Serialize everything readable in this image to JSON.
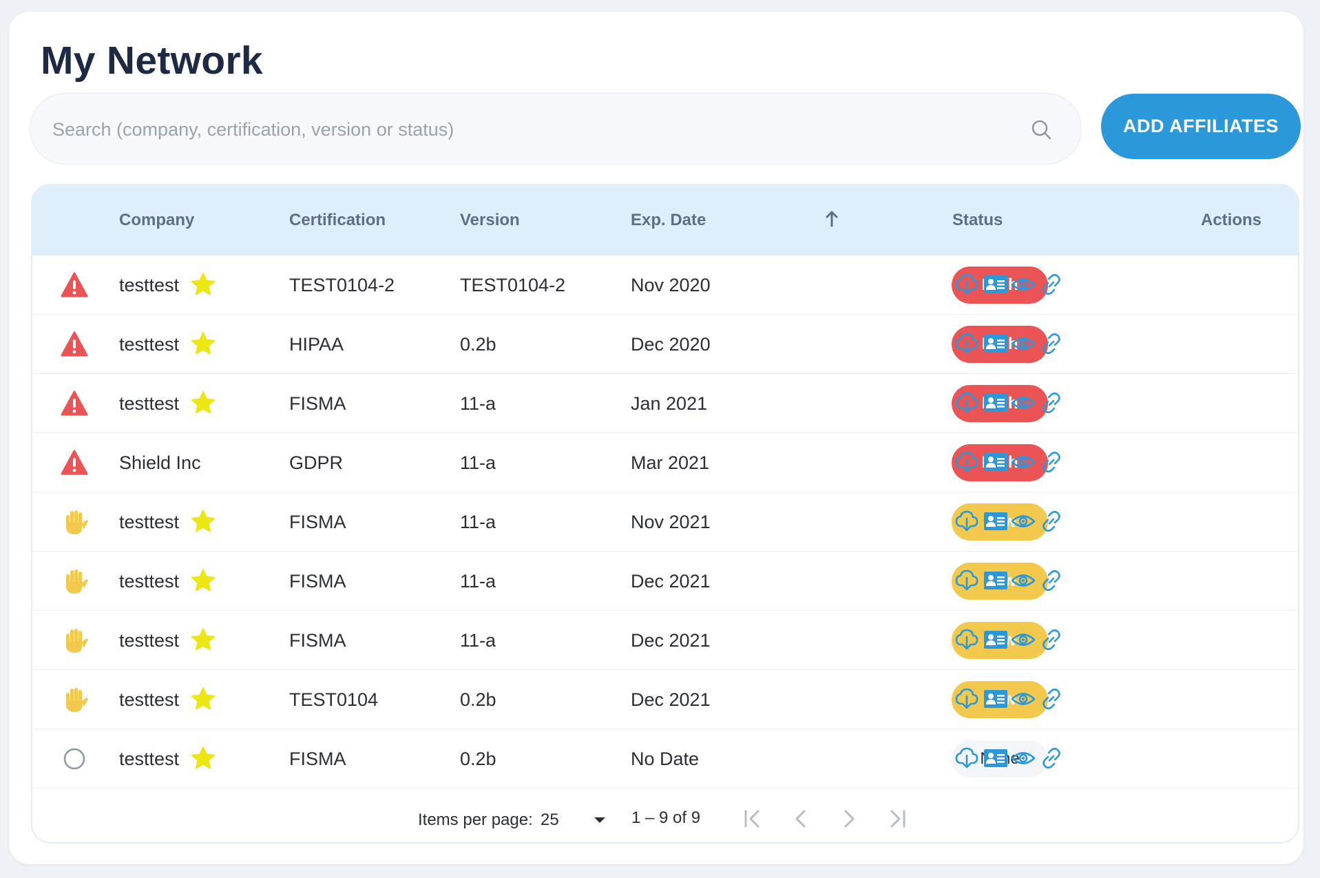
{
  "page": {
    "title": "My Network"
  },
  "search": {
    "placeholder": "Search (company, certification, version or status)"
  },
  "toolbar": {
    "add_label": "ADD AFFILIATES"
  },
  "colors": {
    "accent": "#2a98d9",
    "high": "#ea5455",
    "low": "#f2c94c",
    "none": "#f3f5f8",
    "header_bg": "#deeefa",
    "star": "#ece712"
  },
  "table": {
    "columns": {
      "company": "Company",
      "certification": "Certification",
      "version": "Version",
      "exp_date": "Exp. Date",
      "status": "Status",
      "actions": "Actions"
    },
    "sort": {
      "column": "exp_date",
      "direction": "ascending",
      "icon": "arrow-up-icon"
    },
    "action_icons": [
      "cloud-download-icon",
      "contact-card-icon",
      "eye-icon",
      "link-icon"
    ],
    "rows": [
      {
        "severity_icon": "warning-icon",
        "company": "testtest",
        "starred": true,
        "certification": "TEST0104-2",
        "version": "TEST0104-2",
        "exp_date": "Nov 2020",
        "status": "High"
      },
      {
        "severity_icon": "warning-icon",
        "company": "testtest",
        "starred": true,
        "certification": "HIPAA",
        "version": "0.2b",
        "exp_date": "Dec 2020",
        "status": "High"
      },
      {
        "severity_icon": "warning-icon",
        "company": "testtest",
        "starred": true,
        "certification": "FISMA",
        "version": "11-a",
        "exp_date": "Jan 2021",
        "status": "High"
      },
      {
        "severity_icon": "warning-icon",
        "company": "Shield Inc",
        "starred": false,
        "certification": "GDPR",
        "version": "11-a",
        "exp_date": "Mar 2021",
        "status": "High"
      },
      {
        "severity_icon": "hand-icon",
        "company": "testtest",
        "starred": true,
        "certification": "FISMA",
        "version": "11-a",
        "exp_date": "Nov 2021",
        "status": "Low"
      },
      {
        "severity_icon": "hand-icon",
        "company": "testtest",
        "starred": true,
        "certification": "FISMA",
        "version": "11-a",
        "exp_date": "Dec 2021",
        "status": "Low"
      },
      {
        "severity_icon": "hand-icon",
        "company": "testtest",
        "starred": true,
        "certification": "FISMA",
        "version": "11-a",
        "exp_date": "Dec 2021",
        "status": "Low"
      },
      {
        "severity_icon": "hand-icon",
        "company": "testtest",
        "starred": true,
        "certification": "TEST0104",
        "version": "0.2b",
        "exp_date": "Dec 2021",
        "status": "Low"
      },
      {
        "severity_icon": "circle-icon",
        "company": "testtest",
        "starred": true,
        "certification": "FISMA",
        "version": "0.2b",
        "exp_date": "No Date",
        "status": "None"
      }
    ]
  },
  "pagination": {
    "items_per_page_label": "Items per page:",
    "items_per_page": "25",
    "range": "1 – 9 of 9",
    "icons": [
      "first-page-icon",
      "previous-page-icon",
      "next-page-icon",
      "last-page-icon"
    ]
  }
}
